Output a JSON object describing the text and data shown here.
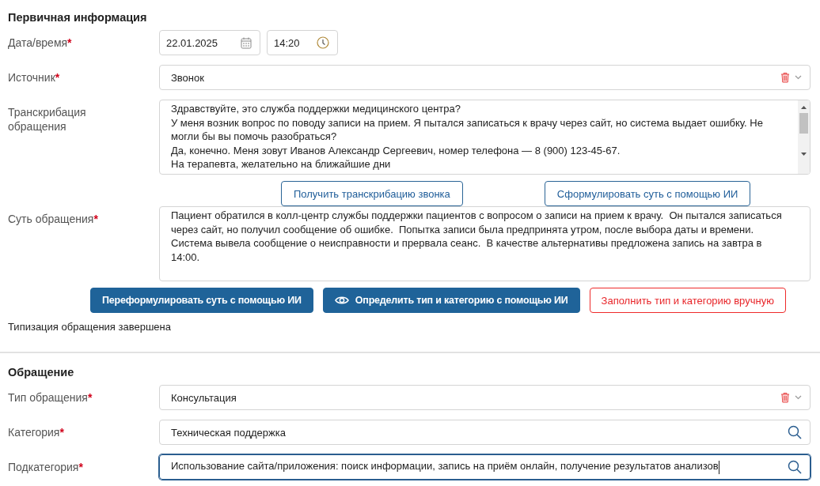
{
  "sections": [
    {
      "title": "Первичная информация",
      "fields": [
        {
          "kind": "datetime",
          "label": "Дата/время",
          "required_mark": "*",
          "date": "22.01.2025",
          "time": "14:20"
        },
        {
          "kind": "select",
          "label": "Источник",
          "required_mark": "*",
          "value": "Звонок"
        },
        {
          "kind": "textarea",
          "label": "Транскрибация обращения",
          "scrollbar": true,
          "lines": [
            "Здравствуйте, это служба поддержки медицинского центра?",
            "У меня возник вопрос по поводу записи на прием. Я пытался записаться к врачу через сайт, но система выдает ошибку. Не могли бы вы помочь разобраться?",
            "Да, конечно. Меня зовут Иванов Александр Сергеевич, номер телефона — 8 (900) 123-45-67.",
            "На терапевта, желательно на ближайшие дни"
          ]
        },
        {
          "kind": "buttons",
          "buttons": [
            {
              "kind": "outline",
              "label": "Получить транскрибацию звонка"
            },
            {
              "kind": "outline",
              "label": "Сформулировать суть с помощью ИИ"
            }
          ]
        },
        {
          "kind": "textarea",
          "label": "Суть обращения",
          "required_mark": "*",
          "scrollbar": false,
          "lines": [
            "Пациент обратился в колл-центр службы поддержки пациентов с вопросом о записи на прием к врачу.  Он пытался записаться",
            "через сайт, но получил сообщение об ошибке.  Попытка записи была предпринята утром, после выбора даты и времени.",
            "Система вывела сообщение о неисправности и прервала сеанс.  В качестве альтернативы предложена запись на завтра в",
            "14:00."
          ]
        },
        {
          "kind": "buttons",
          "buttons": [
            {
              "kind": "primary",
              "label": "Переформулировать суть с помощью ИИ"
            },
            {
              "kind": "primary",
              "label": "Определить тип и категорию с помощью ИИ",
              "icon": true
            },
            {
              "kind": "danger",
              "label": "Заполнить тип и категорию вручную"
            }
          ]
        },
        {
          "kind": "note",
          "text": "Типизация обращения завершена"
        }
      ]
    },
    {
      "title": "Обращение",
      "fields": [
        {
          "kind": "select",
          "label": "Тип обращения",
          "required_mark": "*",
          "value": "Консультация"
        },
        {
          "kind": "lookup",
          "label": "Категория",
          "required_mark": "*",
          "value": "Техническая поддержка",
          "focused": false
        },
        {
          "kind": "lookup",
          "label": "Подкатегория",
          "required_mark": "*",
          "value": "Использование сайта/приложения: поиск информации, запись на приём онлайн, получение результатов анализов",
          "focused": true
        }
      ]
    }
  ]
}
